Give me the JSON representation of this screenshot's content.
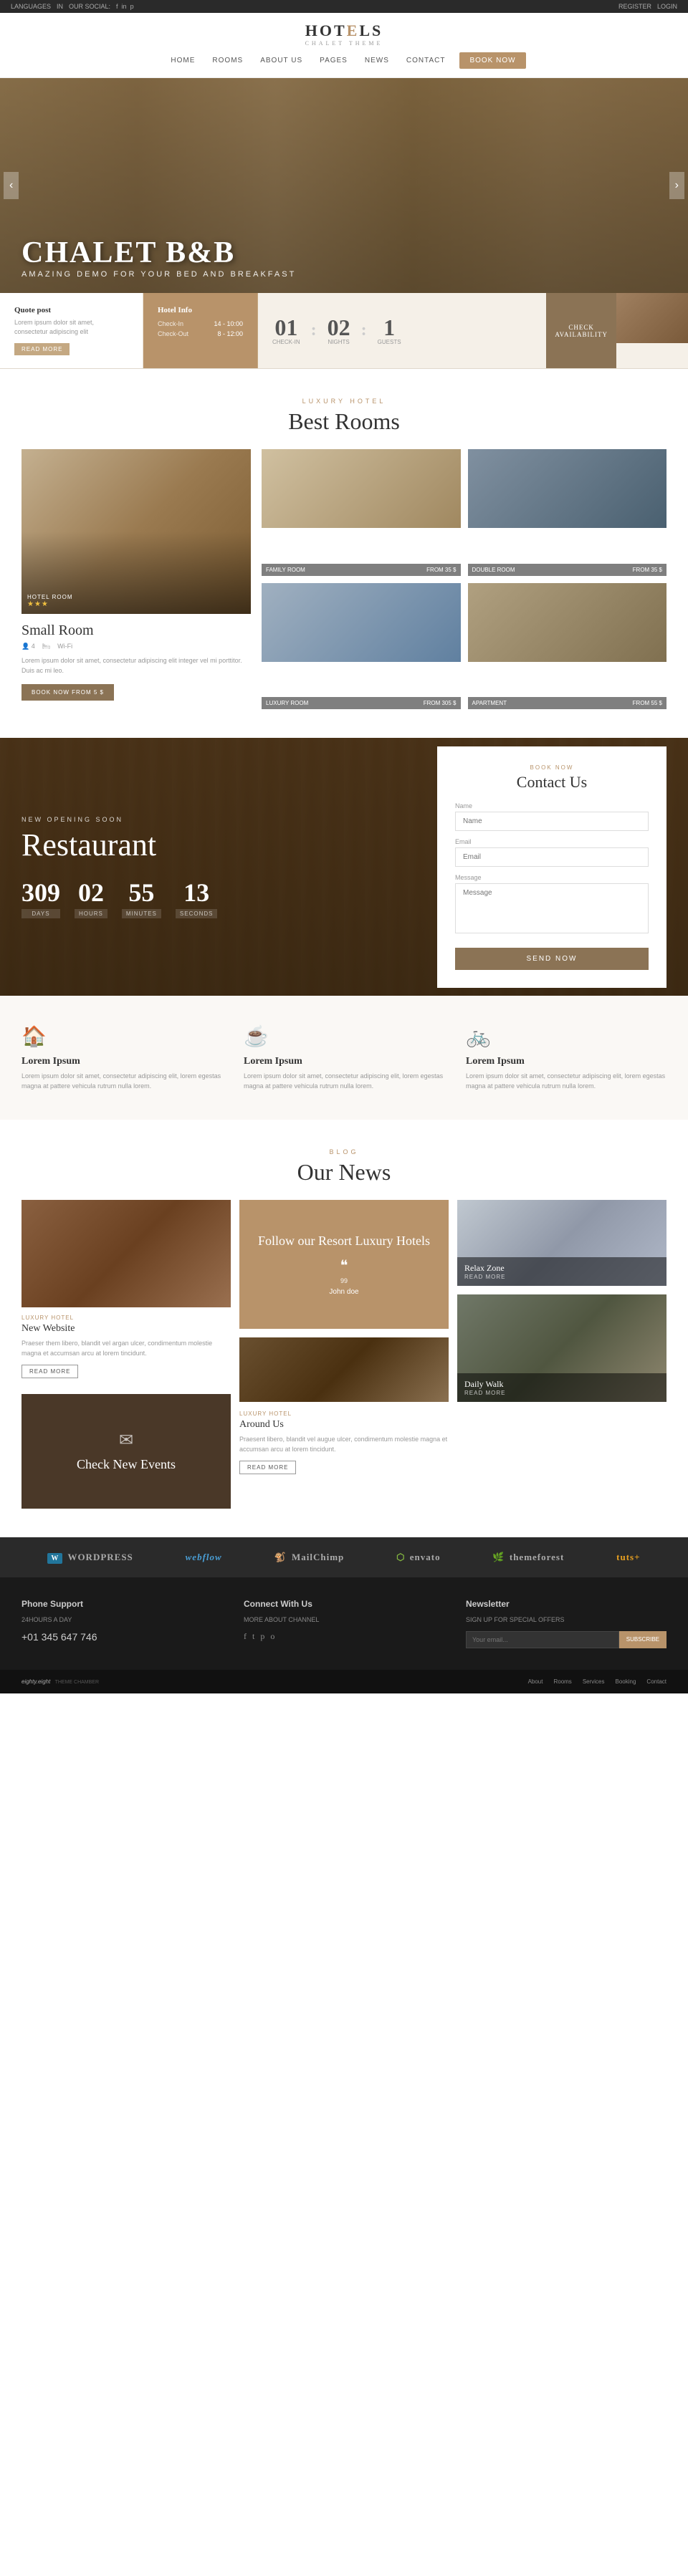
{
  "topbar": {
    "left": {
      "language": "LANGUAGES",
      "social_label": "OUR SOCIAL:",
      "socials": [
        "f",
        "in",
        "p"
      ]
    },
    "right": {
      "register": "REGISTER",
      "login": "LOGIN"
    }
  },
  "header": {
    "logo_text": "HOTELS",
    "logo_highlight": "E",
    "logo_sub": "CHALET THEME",
    "nav": [
      "HOME",
      "ROOMS",
      "ABOUT US",
      "PAGES",
      "NEWS",
      "CONTACT"
    ],
    "book_btn": "BOOK NOW"
  },
  "hero": {
    "title": "CHALET B&B",
    "subtitle": "AMAZING DEMO FOR YOUR  BED AND BREAKFAST",
    "prev": "‹",
    "next": "›"
  },
  "booking": {
    "quote_label": "Quote post",
    "quote_text": "Lorem ipsum dolor sit amet, consectetur adipiscing elit",
    "read_more": "READ MORE",
    "hotel_info_label": "Hotel Info",
    "checkin_label": "Check-In",
    "checkin_time": "14 - 10:00",
    "checkout_label": "Check-Out",
    "checkout_time": "8 - 12:00",
    "checkin_num": "01",
    "nights_num": "02",
    "guests_num": "1",
    "checkin_day_label": "CHECK-IN",
    "nights_label": "NIGHTS",
    "guests_label": "GUESTS",
    "check_avail": "CHECK AVAILABILITY"
  },
  "rooms": {
    "section_label": "LUXURY HOTEL",
    "section_title": "Best Rooms",
    "main_room": {
      "badge": "HOTEL ROOM",
      "stars": "★★★",
      "name": "Small Room",
      "guests_icon": "👤",
      "guests": "4",
      "bed_icon": "🛏",
      "size": "Wi-Fi",
      "desc": "Lorem ipsum dolor sit amet, consectetur adipiscing elit integer vel mi porttitor. Duis ac mi leo.",
      "book_btn": "BOOK NOW FROM 5 $"
    },
    "thumb_rooms": [
      {
        "label": "FAMILY ROOM",
        "price": "FROM 35 $",
        "img": "img2"
      },
      {
        "label": "DOUBLE ROOM",
        "price": "FROM 35 $",
        "img": "img3"
      },
      {
        "label": "LUXURY ROOM",
        "price": "FROM 305 $",
        "img": "img4"
      },
      {
        "label": "APARTMENT",
        "price": "FROM 55 $",
        "img": "img5"
      }
    ]
  },
  "restaurant": {
    "opening_label": "NEW OPENING SOON",
    "title": "Restaurant",
    "countdown": [
      {
        "num": "309",
        "label": "DAYS"
      },
      {
        "num": "02",
        "label": "HOURS"
      },
      {
        "num": "55",
        "label": "MINUTES"
      },
      {
        "num": "13",
        "label": "SECONDS"
      }
    ],
    "contact": {
      "label": "BOOK NOW",
      "title": "Contact Us",
      "name_label": "Name",
      "email_label": "Email",
      "message_label": "Message",
      "send_btn": "SEND NOW"
    }
  },
  "features": [
    {
      "icon": "🏠",
      "title": "Lorem Ipsum",
      "desc": "Lorem ipsum dolor sit amet, consectetur adipiscing elit, lorem egestas magna at pattere vehicula rutrum nulla lorem."
    },
    {
      "icon": "☕",
      "title": "Lorem Ipsum",
      "desc": "Lorem ipsum dolor sit amet, consectetur adipiscing elit, lorem egestas magna at pattere vehicula rutrum nulla lorem."
    },
    {
      "icon": "🚲",
      "title": "Lorem Ipsum",
      "desc": "Lorem ipsum dolor sit amet, consectetur adipiscing elit, lorem egestas magna at pattere vehicula rutrum nulla lorem."
    }
  ],
  "news": {
    "section_label": "BLOG",
    "section_title": "Our News",
    "col1": {
      "card1": {
        "category": "LUXURY HOTEL",
        "title": "New Website",
        "excerpt": "Praeser them libero, blandit vel argan ulcer, condimentum molestie magna et accumsan arcu at lorem tincidunt.",
        "read_more": "READ MORE"
      },
      "card2_title": "Check New Events"
    },
    "col2": {
      "follow_title": "Follow our Resort Luxury Hotels",
      "follow_quote": "99",
      "follow_author": "John doe",
      "small_img_cat": "LUXURY HOTEL",
      "small_card_title": "Around Us",
      "small_card_excerpt": "Praesent libero, blandit vel augue ulcer, condimentum molestie magna et accumsan arcu at lorem tincidunt.",
      "small_card_read_more": "READ MORE"
    },
    "col3": {
      "relax_title": "Relax Zone",
      "relax_read": "READ MORE",
      "daily_title": "Daily Walk",
      "daily_read": "READ MORE"
    }
  },
  "partners": [
    {
      "name": "WORDPRESS"
    },
    {
      "name": "webflow"
    },
    {
      "name": "MailChimp"
    },
    {
      "name": "envato"
    },
    {
      "name": "themeforest"
    },
    {
      "name": "tuts+"
    }
  ],
  "footer": {
    "col1": {
      "title": "Phone Support",
      "sub": "24HOURS A DAY",
      "phone": "+01 345 647 746"
    },
    "col2": {
      "title": "Connect With Us",
      "sub": "MORE ABOUT CHANNEL",
      "socials": [
        "f",
        "t",
        "p",
        "o"
      ]
    },
    "col3": {
      "title": "Newsletter",
      "sub": "SIGN UP FOR SPECIAL OFFERS",
      "placeholder": "Your email...",
      "subscribe_btn": "SUBSCRIBE"
    }
  },
  "footer_bottom": {
    "brand": "eighty.eight",
    "brand_sub": "THEME CHAMBER",
    "links": [
      "About",
      "Rooms",
      "Services",
      "Booking",
      "Contact"
    ]
  }
}
